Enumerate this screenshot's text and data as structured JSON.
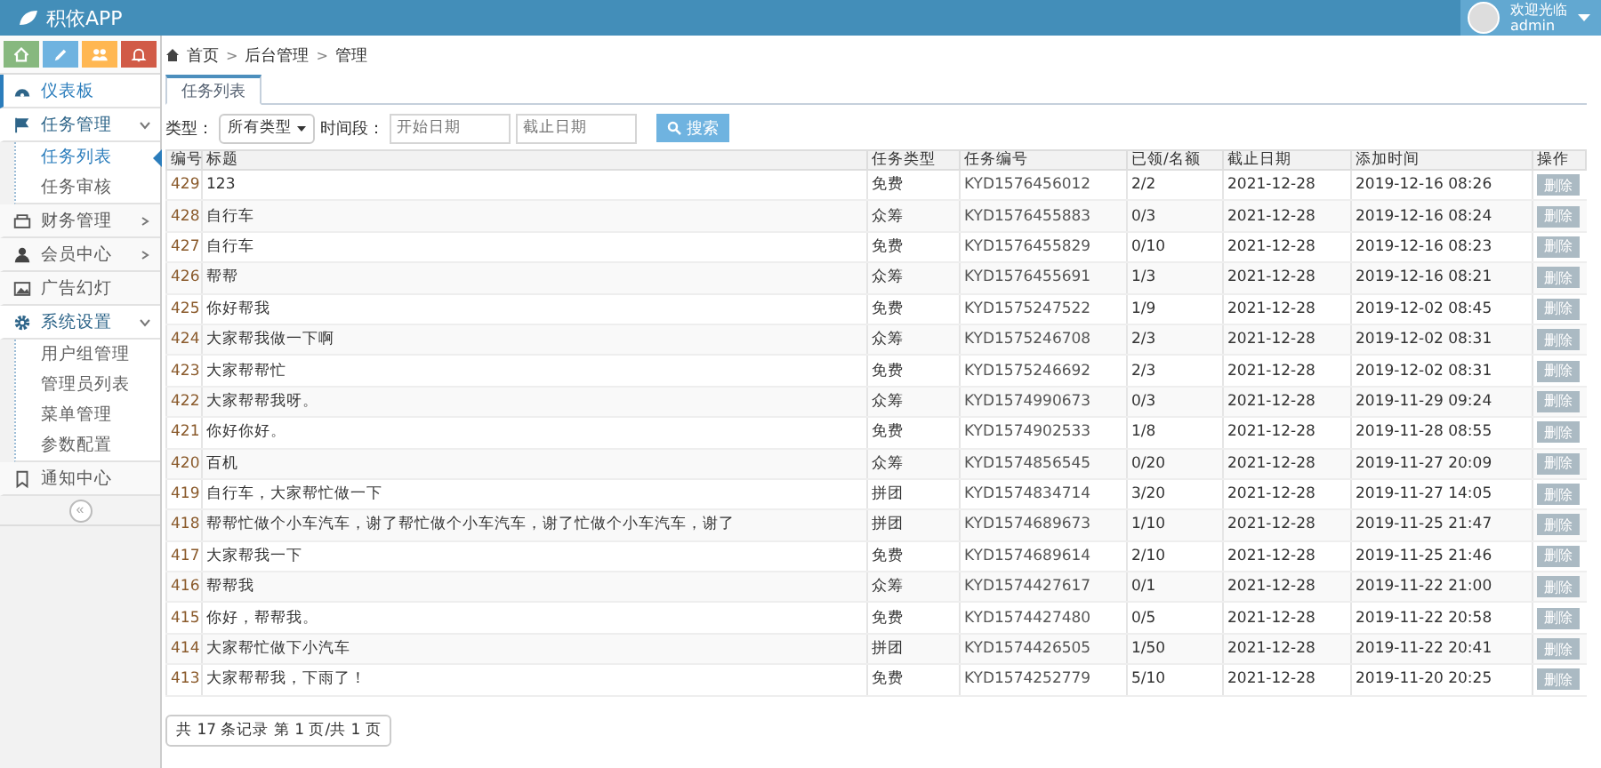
{
  "header": {
    "app_name": "积依APP",
    "user": {
      "greeting": "欢迎光临",
      "name": "admin"
    }
  },
  "sidebar": {
    "shortcuts": [
      {
        "kind": "home",
        "color": "#87b87f"
      },
      {
        "kind": "pencil",
        "color": "#6fb3e0"
      },
      {
        "kind": "users",
        "color": "#ffb752"
      },
      {
        "kind": "bell",
        "color": "#d15b47"
      }
    ],
    "items": [
      {
        "kind": "dashboard",
        "label": "仪表板",
        "selected": true
      },
      {
        "kind": "flag",
        "label": "任务管理",
        "selected": false,
        "expanded": true,
        "children": [
          {
            "label": "任务列表",
            "selected": true
          },
          {
            "label": "任务审核",
            "selected": false
          }
        ]
      },
      {
        "kind": "finance",
        "label": "财务管理",
        "selected": false,
        "expanded": false
      },
      {
        "kind": "member",
        "label": "会员中心",
        "selected": false,
        "expanded": false
      },
      {
        "kind": "image",
        "label": "广告幻灯",
        "selected": false
      },
      {
        "kind": "gear",
        "label": "系统设置",
        "selected": false,
        "expanded": true,
        "children": [
          {
            "label": "用户组管理",
            "selected": false
          },
          {
            "label": "管理员列表",
            "selected": false
          },
          {
            "label": "菜单管理",
            "selected": false
          },
          {
            "label": "参数配置",
            "selected": false
          }
        ]
      },
      {
        "kind": "bookmark",
        "label": "通知中心",
        "selected": false
      }
    ],
    "collapse_label": "«"
  },
  "breadcrumb": [
    {
      "kind": "link",
      "text": "首页"
    },
    {
      "kind": "separator",
      "text": ">"
    },
    {
      "kind": "link",
      "text": "后台管理"
    },
    {
      "kind": "separator",
      "text": ">"
    },
    {
      "kind": "link",
      "text": "管理"
    }
  ],
  "tabs": [
    {
      "label": "任务列表",
      "selected": true
    }
  ],
  "filter": {
    "type_label": "类型：",
    "type_value": "所有类型",
    "period_label": "时间段：",
    "start_placeholder": "开始日期",
    "end_placeholder": "截止日期",
    "search_button": "搜索"
  },
  "table": {
    "columns": [
      "编号",
      "标题",
      "任务类型",
      "任务编号",
      "已领/名额",
      "截止日期",
      "添加时间",
      "操作"
    ],
    "rows": [
      {
        "cells": [
          "429",
          "123",
          "免费",
          "KYD1576456012",
          "2/2",
          "2021-12-28",
          "2019-12-16 08:26"
        ],
        "action": "删除"
      },
      {
        "cells": [
          "428",
          "自行车",
          "众筹",
          "KYD1576455883",
          "0/3",
          "2021-12-28",
          "2019-12-16 08:24"
        ],
        "action": "删除"
      },
      {
        "cells": [
          "427",
          "自行车",
          "免费",
          "KYD1576455829",
          "0/10",
          "2021-12-28",
          "2019-12-16 08:23"
        ],
        "action": "删除"
      },
      {
        "cells": [
          "426",
          "帮帮",
          "众筹",
          "KYD1576455691",
          "1/3",
          "2021-12-28",
          "2019-12-16 08:21"
        ],
        "action": "删除"
      },
      {
        "cells": [
          "425",
          "你好帮我",
          "免费",
          "KYD1575247522",
          "1/9",
          "2021-12-28",
          "2019-12-02 08:45"
        ],
        "action": "删除"
      },
      {
        "cells": [
          "424",
          "大家帮我做一下啊",
          "众筹",
          "KYD1575246708",
          "2/3",
          "2021-12-28",
          "2019-12-02 08:31"
        ],
        "action": "删除"
      },
      {
        "cells": [
          "423",
          "大家帮帮忙",
          "免费",
          "KYD1575246692",
          "2/3",
          "2021-12-28",
          "2019-12-02 08:31"
        ],
        "action": "删除"
      },
      {
        "cells": [
          "422",
          "大家帮帮我呀。",
          "众筹",
          "KYD1574990673",
          "0/3",
          "2021-12-28",
          "2019-11-29 09:24"
        ],
        "action": "删除"
      },
      {
        "cells": [
          "421",
          "你好你好。",
          "免费",
          "KYD1574902533",
          "1/8",
          "2021-12-28",
          "2019-11-28 08:55"
        ],
        "action": "删除"
      },
      {
        "cells": [
          "420",
          "百机",
          "众筹",
          "KYD1574856545",
          "0/20",
          "2021-12-28",
          "2019-11-27 20:09"
        ],
        "action": "删除"
      },
      {
        "cells": [
          "419",
          "自行车，大家帮忙做一下",
          "拼团",
          "KYD1574834714",
          "3/20",
          "2021-12-28",
          "2019-11-27 14:05"
        ],
        "action": "删除"
      },
      {
        "cells": [
          "418",
          "帮帮忙做个小车汽车，谢了帮忙做个小车汽车，谢了忙做个小车汽车，谢了",
          "拼团",
          "KYD1574689673",
          "1/10",
          "2021-12-28",
          "2019-11-25 21:47"
        ],
        "action": "删除"
      },
      {
        "cells": [
          "417",
          "大家帮我一下",
          "免费",
          "KYD1574689614",
          "2/10",
          "2021-12-28",
          "2019-11-25 21:46"
        ],
        "action": "删除"
      },
      {
        "cells": [
          "416",
          "帮帮我",
          "众筹",
          "KYD1574427617",
          "0/1",
          "2021-12-28",
          "2019-11-22 21:00"
        ],
        "action": "删除"
      },
      {
        "cells": [
          "415",
          "你好，帮帮我。",
          "免费",
          "KYD1574427480",
          "0/5",
          "2021-12-28",
          "2019-11-22 20:58"
        ],
        "action": "删除"
      },
      {
        "cells": [
          "414",
          "大家帮忙做下小汽车",
          "拼团",
          "KYD1574426505",
          "1/50",
          "2021-12-28",
          "2019-11-22 20:41"
        ],
        "action": "删除"
      },
      {
        "cells": [
          "413",
          "大家帮帮我，下雨了！",
          "免费",
          "KYD1574252779",
          "5/10",
          "2021-12-28",
          "2019-11-20 20:25"
        ],
        "action": "删除"
      }
    ]
  },
  "pagination": "共 17 条记录 第 1 页/共 1 页"
}
